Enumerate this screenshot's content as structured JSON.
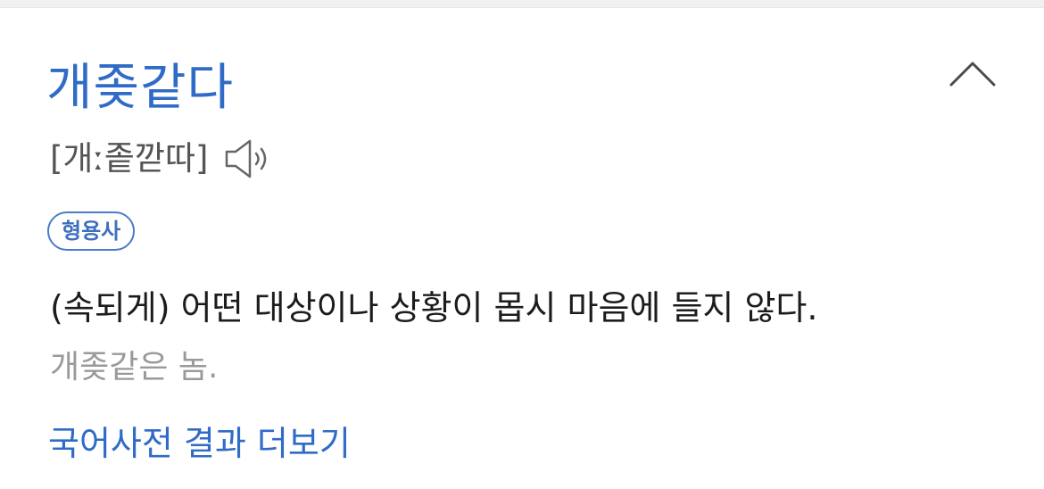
{
  "entry": {
    "headword": "개좆같다",
    "pronunciation": "[개ː좉깓따]",
    "part_of_speech": "형용사",
    "definition": "(속되게) 어떤 대상이나 상황이 몹시 마음에 들지 않다.",
    "example": "개좆같은 놈.",
    "more_link": "국어사전 결과 더보기"
  },
  "icons": {
    "collapse": "chevron-up-icon",
    "audio": "speaker-icon"
  },
  "colors": {
    "headword": "#2f6bc7",
    "link": "#2f6bc7",
    "badge": "#4a7cc9",
    "example": "#9a9a9a",
    "definition": "#1c1c1c"
  }
}
